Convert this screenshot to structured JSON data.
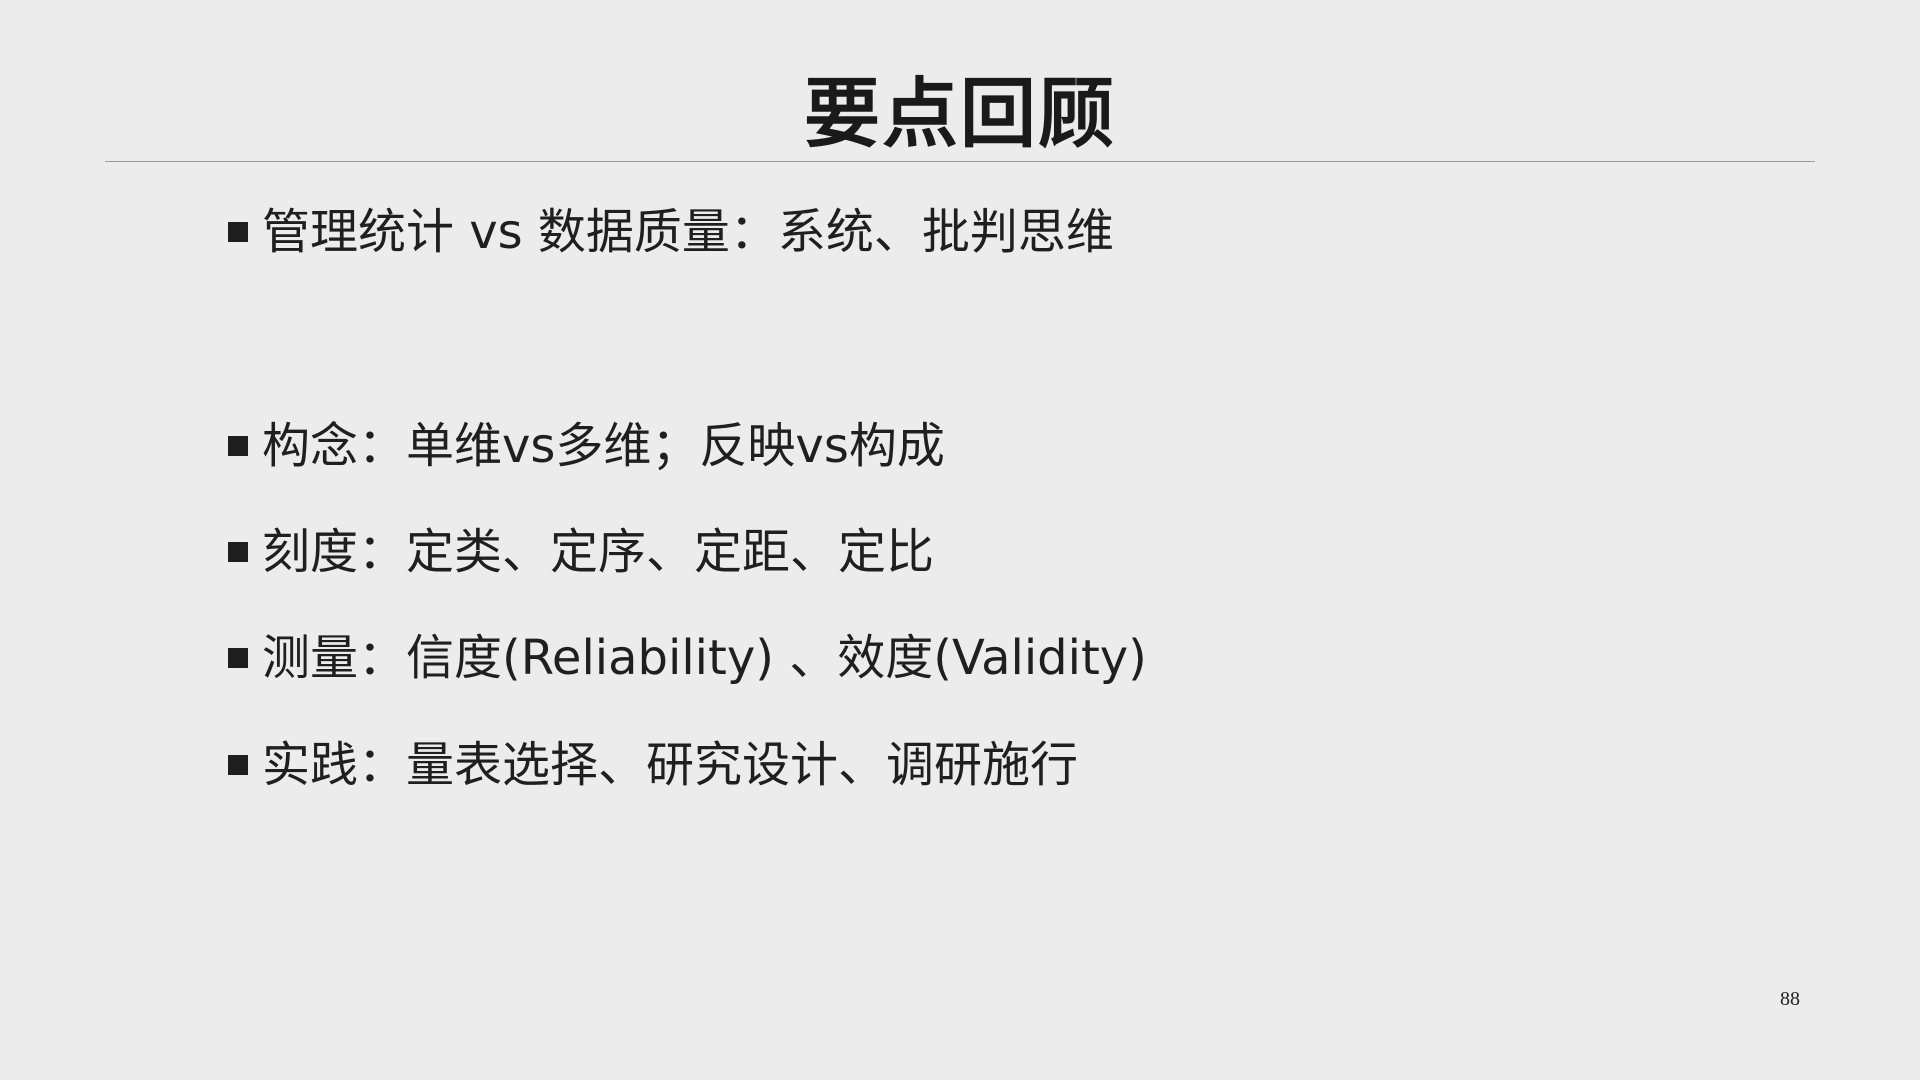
{
  "slide": {
    "title": "要点回顾",
    "bullets": [
      {
        "text": "管理统计 vs 数据质量：系统、批判思维"
      },
      {
        "text": "构念：单维vs多维；反映vs构成"
      },
      {
        "text": "刻度：定类、定序、定距、定比"
      },
      {
        "text": "测量：信度(Reliability) 、效度(Validity)"
      },
      {
        "text": "实践：量表选择、研究设计、调研施行"
      }
    ],
    "page_number": "88"
  }
}
